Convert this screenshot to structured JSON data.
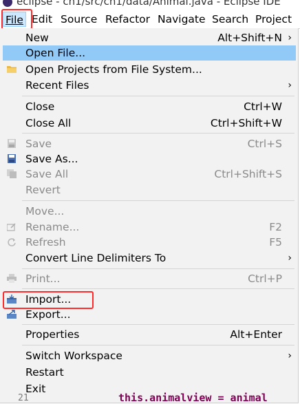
{
  "window": {
    "title": "eclipse - ch1/src/ch1/data/Animal.java - Eclipse IDE"
  },
  "menubar": {
    "items": [
      {
        "label": "File",
        "active": true
      },
      {
        "label": "Edit"
      },
      {
        "label": "Source"
      },
      {
        "label": "Refactor"
      },
      {
        "label": "Navigate"
      },
      {
        "label": "Search"
      },
      {
        "label": "Project"
      }
    ]
  },
  "file_menu": {
    "new": {
      "label": "New",
      "accel": "Alt+Shift+N"
    },
    "open_file": {
      "label": "Open File...",
      "selected": true
    },
    "open_projects": {
      "label": "Open Projects from File System..."
    },
    "recent_files": {
      "label": "Recent Files"
    },
    "close": {
      "label": "Close",
      "accel": "Ctrl+W"
    },
    "close_all": {
      "label": "Close All",
      "accel": "Ctrl+Shift+W"
    },
    "save": {
      "label": "Save",
      "accel": "Ctrl+S",
      "disabled": true
    },
    "save_as": {
      "label": "Save As..."
    },
    "save_all": {
      "label": "Save All",
      "accel": "Ctrl+Shift+S",
      "disabled": true
    },
    "revert": {
      "label": "Revert",
      "disabled": true
    },
    "move": {
      "label": "Move...",
      "disabled": true
    },
    "rename": {
      "label": "Rename...",
      "accel": "F2",
      "disabled": true
    },
    "refresh": {
      "label": "Refresh",
      "accel": "F5",
      "disabled": true
    },
    "convert_line_delimiters": {
      "label": "Convert Line Delimiters To"
    },
    "print": {
      "label": "Print...",
      "accel": "Ctrl+P",
      "disabled": true
    },
    "import": {
      "label": "Import..."
    },
    "export": {
      "label": "Export..."
    },
    "properties": {
      "label": "Properties",
      "accel": "Alt+Enter"
    },
    "switch_workspace": {
      "label": "Switch Workspace"
    },
    "restart": {
      "label": "Restart"
    },
    "exit": {
      "label": "Exit"
    }
  },
  "editor_peek": {
    "line_number": "21",
    "code": "this.animalview = animal"
  },
  "colors": {
    "menu_bg": "#f2f2f2",
    "selected_bg": "#91c9f7",
    "active_menubar_bg": "#cce8ff",
    "highlight_red": "#ff2b2b",
    "disabled_text": "#8a8a8a",
    "keyword": "#7f0055"
  },
  "icons": {
    "open_projects": "folder-icon",
    "save": "save-icon",
    "save_as": "save-as-icon",
    "save_all": "save-all-icon",
    "rename": "rename-icon",
    "refresh": "refresh-icon",
    "print": "print-icon",
    "import": "import-icon",
    "export": "export-icon",
    "submenu": "chevron-right-icon"
  }
}
